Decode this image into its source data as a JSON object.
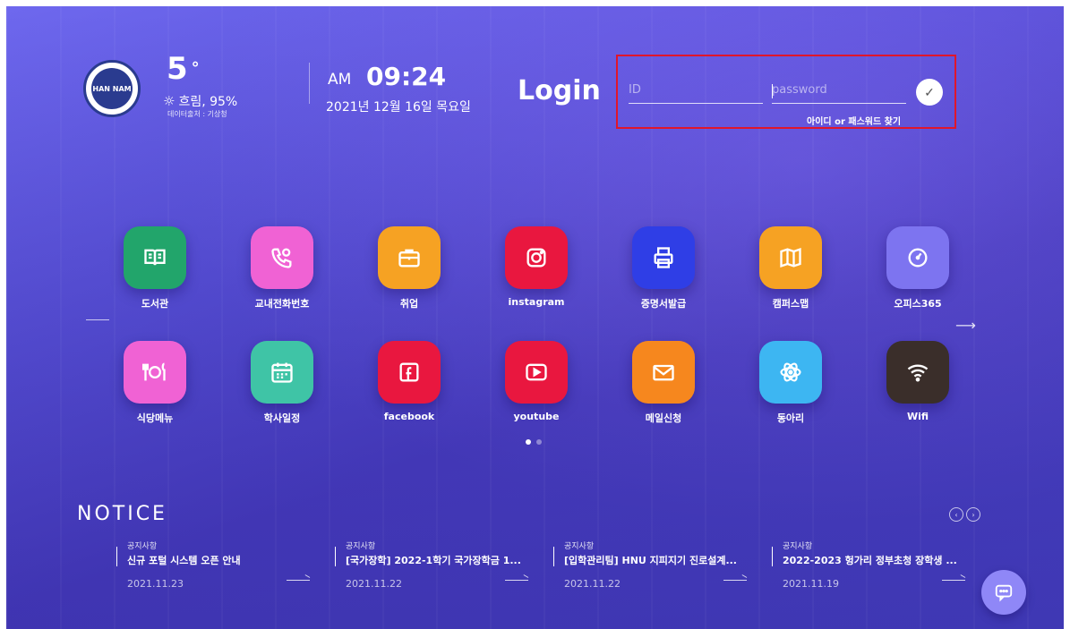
{
  "header": {
    "logo_text": "HAN NAM",
    "temperature": "5",
    "temperature_unit": "°",
    "weather_icon": "sun-icon",
    "weather_text": "흐림, 95%",
    "source": "데이터출처 : 기상청",
    "ampm": "AM",
    "time": "09:24",
    "date": "2021년 12월 16일 목요일"
  },
  "login": {
    "title": "Login",
    "id_placeholder": "ID",
    "password_placeholder": "password",
    "submit_icon": "check-icon",
    "find_link": "아이디 or 패스워드 찾기"
  },
  "apps": [
    {
      "label": "도서관",
      "icon": "book-icon",
      "color": "#22a56b"
    },
    {
      "label": "교내전화번호",
      "icon": "phone-icon",
      "color": "#f062d4"
    },
    {
      "label": "취업",
      "icon": "briefcase-icon",
      "color": "#f6a223"
    },
    {
      "label": "instagram",
      "icon": "instagram-icon",
      "color": "#e9173f"
    },
    {
      "label": "증명서발급",
      "icon": "printer-icon",
      "color": "#2f3ee6"
    },
    {
      "label": "캠퍼스맵",
      "icon": "map-icon",
      "color": "#f6a223"
    },
    {
      "label": "오피스365",
      "icon": "gauge-icon",
      "color": "#7d74f0"
    },
    {
      "label": "식당메뉴",
      "icon": "dining-icon",
      "color": "#f062d4"
    },
    {
      "label": "학사일정",
      "icon": "calendar-icon",
      "color": "#3fc4a6"
    },
    {
      "label": "facebook",
      "icon": "facebook-icon",
      "color": "#e9173f"
    },
    {
      "label": "youtube",
      "icon": "youtube-icon",
      "color": "#e9173f"
    },
    {
      "label": "메일신청",
      "icon": "mail-icon",
      "color": "#f6871e"
    },
    {
      "label": "동아리",
      "icon": "atom-icon",
      "color": "#3db6f2"
    },
    {
      "label": "Wifi",
      "icon": "wifi-icon",
      "color": "#3a2e2a"
    }
  ],
  "notice": {
    "title": "NOTICE",
    "items": [
      {
        "category": "공지사항",
        "title": "신규 포털 시스템 오픈 안내",
        "date": "2021.11.23"
      },
      {
        "category": "공지사항",
        "title": "[국가장학] 2022-1학기 국가장학금 1...",
        "date": "2021.11.22"
      },
      {
        "category": "공지사항",
        "title": "[입학관리팀] HNU 지피지기 진로설계...",
        "date": "2021.11.22"
      },
      {
        "category": "공지사항",
        "title": "2022-2023 헝가리 정부초청 장학생 ...",
        "date": "2021.11.19"
      }
    ]
  }
}
